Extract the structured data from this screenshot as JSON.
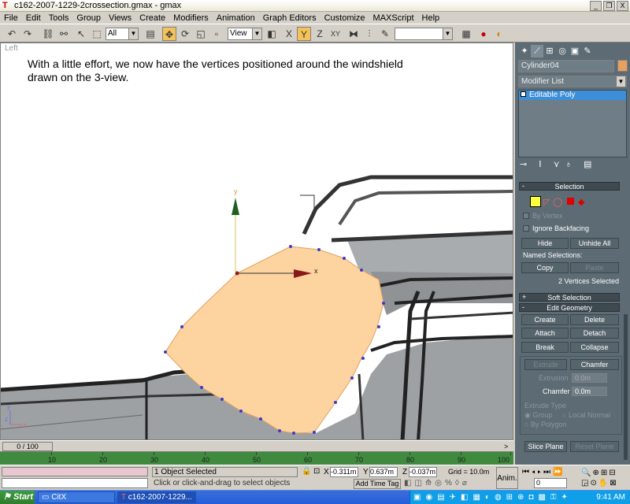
{
  "window": {
    "title": "c162-2007-1229-2crossection.gmax - gmax",
    "min": "_",
    "max": "❐",
    "close": "X"
  },
  "menu": [
    "File",
    "Edit",
    "Tools",
    "Group",
    "Views",
    "Create",
    "Modifiers",
    "Animation",
    "Graph Editors",
    "Customize",
    "MAXScript",
    "Help"
  ],
  "toolbar": {
    "filter_value": "All",
    "coord_value": "View"
  },
  "viewport": {
    "label": "Left",
    "caption": "With a little effort, we now have the vertices positioned around the windshield drawn on the 3-view.",
    "gizmo_y": "y",
    "gizmo_x": "x",
    "axis_y": "y",
    "axis_z": "z",
    "axis_x": "x"
  },
  "panel": {
    "object_name": "Cylinder04",
    "modifier_list": "Modifier List",
    "stack_item": "Editable Poly",
    "selection": {
      "title": "Selection",
      "by_vertex": "By Vertex",
      "ignore_backfacing": "Ignore Backfacing",
      "hide": "Hide",
      "unhide_all": "Unhide All",
      "named_selections": "Named Selections:",
      "copy": "Copy",
      "paste": "Paste",
      "status": "2 Vertices Selected"
    },
    "soft_selection": {
      "title": "Soft Selection",
      "sign": "+"
    },
    "edit_geometry": {
      "title": "Edit Geometry",
      "sign": "-",
      "create": "Create",
      "delete": "Delete",
      "attach": "Attach",
      "detach": "Detach",
      "break": "Break",
      "collapse": "Collapse",
      "extrude": "Extrude",
      "chamfer": "Chamfer",
      "extrusion_label": "Extrusion",
      "extrusion_value": "0.0m",
      "chamfer_label": "Chamfer",
      "chamfer_value": "0.0m",
      "extrude_type": "Extrude Type",
      "group": "Group",
      "local_normal": "Local Normal",
      "by_polygon": "By Polygon",
      "slice_plane": "Slice Plane",
      "reset_plane": "Reset Plane"
    },
    "selection_sign": "-"
  },
  "timeline": {
    "slider": "0 / 100",
    "ticks": [
      "10",
      "20",
      "30",
      "40",
      "50",
      "60",
      "70",
      "80",
      "90",
      "100"
    ]
  },
  "status": {
    "selected": "1 Object Selected",
    "prompt": "Click or click-and-drag to select objects",
    "x_label": "X",
    "x_value": "-0.311m",
    "y_label": "Y",
    "y_value": "0.637m",
    "z_label": "Z",
    "z_value": "-0.037m",
    "grid": "Grid = 10.0m",
    "add_time_tag": "Add Time Tag",
    "anim": "Anim.",
    "frame": "0"
  },
  "taskbar": {
    "start": "Start",
    "tasks": [
      "CitX",
      "c162-2007-1229..."
    ],
    "time": "9:41 AM"
  }
}
